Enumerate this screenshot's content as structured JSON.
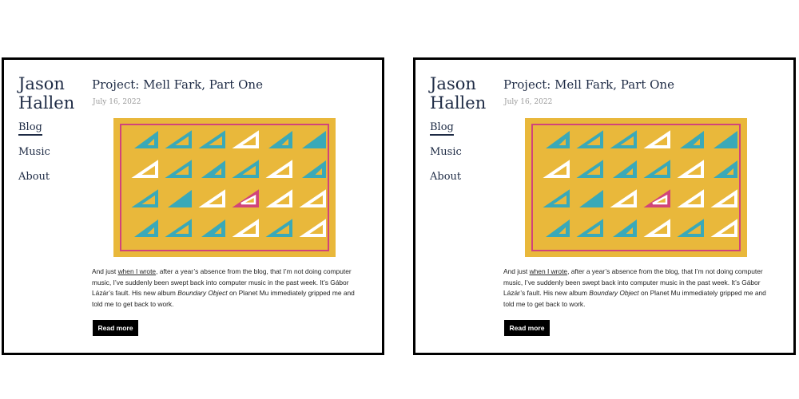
{
  "site": {
    "name_line1": "Jason",
    "name_line2": "Hallen"
  },
  "nav": {
    "blog": "Blog",
    "music": "Music",
    "about": "About"
  },
  "post": {
    "title": "Project: Mell Fark, Part One",
    "date": "July 16, 2022",
    "excerpt_before_link": "And just ",
    "link_text": "when I wrote",
    "excerpt_mid": ", after a year’s absence from the blog, that I’m not doing computer music, I’ve suddenly been swept back into computer music in the past week. It’s Gábor Lázár’s fault. His new album ",
    "album": "Boundary Object",
    "excerpt_end": " on Planet Mu immediately gripped me and told me to get back to work.",
    "read_more": "Read more"
  },
  "artwork": {
    "colors": {
      "background": "#e9b83b",
      "border": "#d1447a",
      "teal": "#3aa9b8",
      "white": "#ffffff",
      "accent": "#d1447a"
    },
    "grid": [
      [
        "teal-partial",
        "teal-outline",
        "teal-outline",
        "white-outline",
        "teal-partial",
        "teal-solid"
      ],
      [
        "white-outline",
        "teal-outline",
        "teal-partial",
        "teal-outline",
        "white-outline",
        "teal-partial"
      ],
      [
        "teal-outline",
        "teal-solid",
        "white-outline",
        "pink-outline",
        "white-outline",
        "white-outline"
      ],
      [
        "teal-partial",
        "teal-outline",
        "teal-partial",
        "white-outline",
        "teal-outline",
        "white-outline"
      ]
    ]
  }
}
